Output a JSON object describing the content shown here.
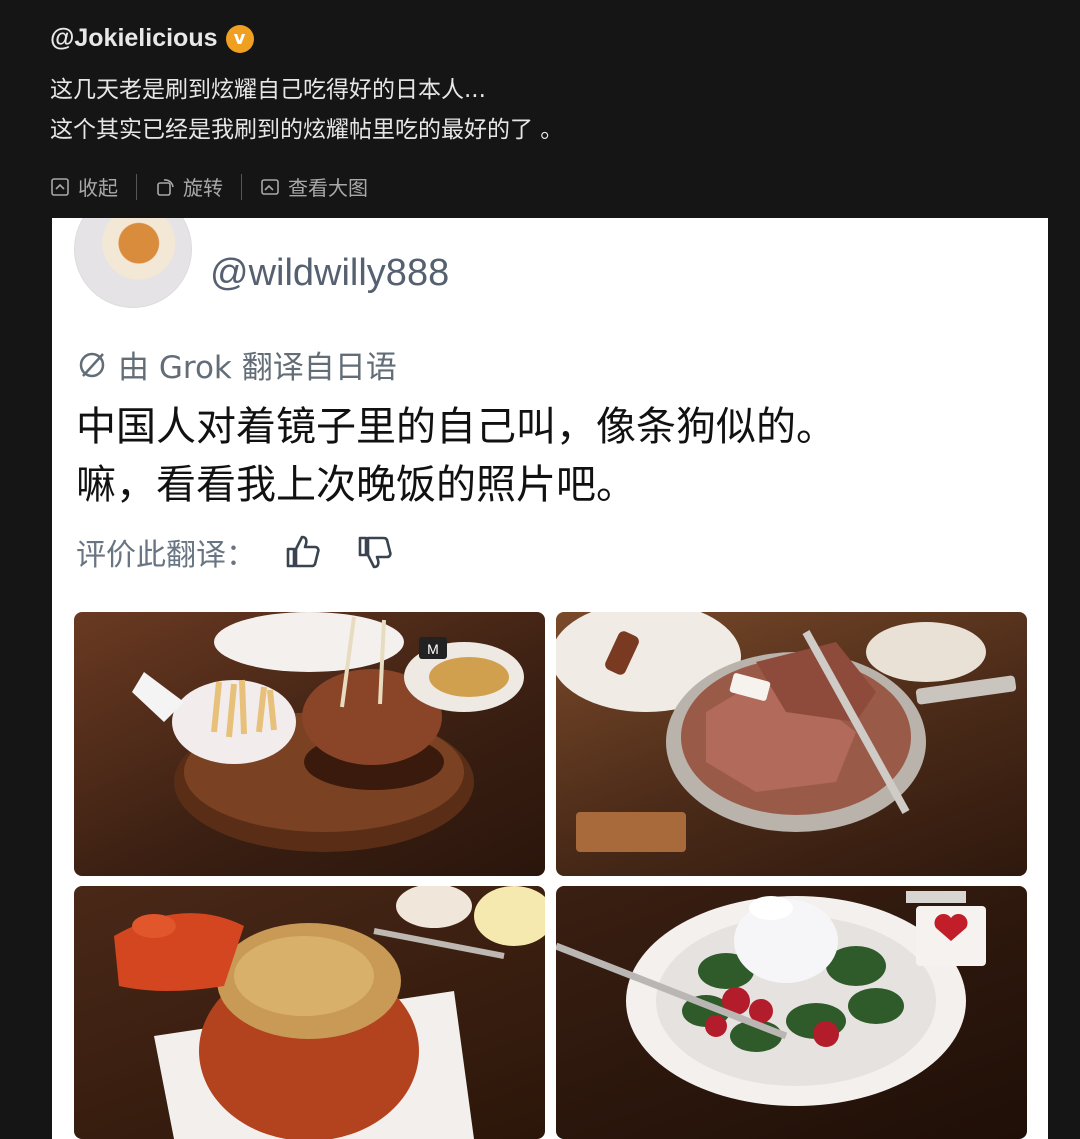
{
  "post": {
    "author": "@Jokielicious",
    "verified_badge": "v",
    "text_lines": [
      "这几天老是刷到炫耀自己吃得好的日本人...",
      "这个其实已经是我刷到的炫耀帖里吃的最好的了 。"
    ],
    "actions": {
      "collapse": "收起",
      "rotate": "旋转",
      "view_large": "查看大图"
    }
  },
  "embedded": {
    "handle": "@wildwilly888",
    "translation_note": "由 Grok 翻译自日语",
    "tweet_lines": [
      "中国人对着镜子里的自己叫，像条狗似的。",
      "嘛，看看我上次晚饭的照片吧。"
    ],
    "rate_label": "评价此翻译：",
    "photo_sign_label": "M"
  },
  "icons": {
    "collapse": "collapse-icon",
    "rotate": "rotate-icon",
    "view_large": "image-icon",
    "grok": "grok-icon",
    "thumbs_up": "thumbs-up-icon",
    "thumbs_down": "thumbs-down-icon"
  },
  "colors": {
    "background": "#151515",
    "verified": "#f0a020",
    "card": "#ffffff",
    "handle": "#556170"
  }
}
